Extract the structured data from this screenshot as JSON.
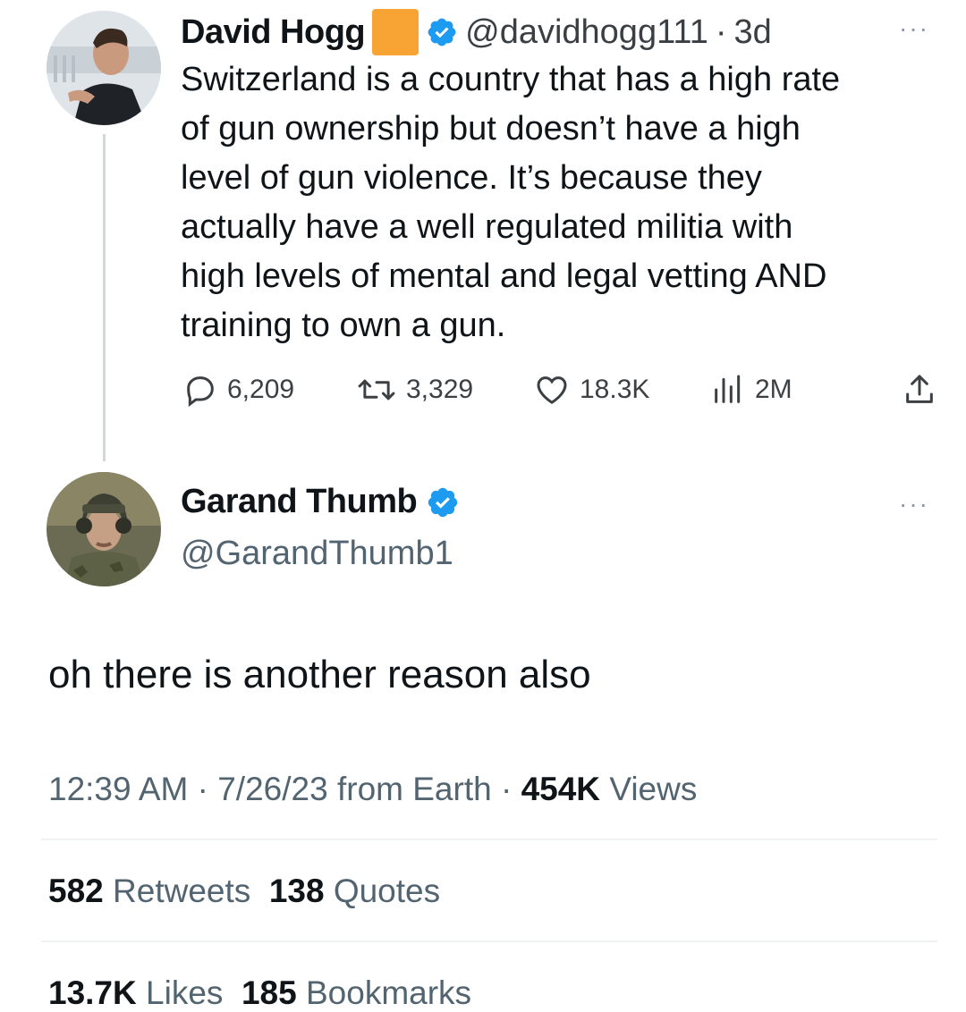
{
  "quoted_tweet": {
    "author_name": "David Hogg",
    "handle": "@davidhogg111",
    "separator": "·",
    "age": "3d",
    "more": "···",
    "text": "Switzerland is a country that has a high rate of gun ownership but doesn’t have a high level of gun violence. It’s because they actually have a well regulated militia with high levels of mental and legal vetting AND training to own a gun.",
    "lines": [
      "Switzerland is a country that has a high rate",
      "of gun ownership but doesn’t have a high",
      "level of gun violence. It’s because they",
      "actually have a well regulated militia with",
      "high levels of mental and legal vetting AND",
      "training to own a gun."
    ],
    "actions": {
      "replies": "6,209",
      "retweets": "3,329",
      "likes": "18.3K",
      "views": "2M"
    }
  },
  "main_tweet": {
    "author_name": "Garand Thumb",
    "handle": "@GarandThumb1",
    "more": "···",
    "text": "oh there is another reason also",
    "time": "12:39 AM",
    "date": "7/26/23",
    "source": "from Earth",
    "dot": "·",
    "views_count": "454K",
    "views_label": "Views",
    "retweets_count": "582",
    "retweets_label": "Retweets",
    "quotes_count": "138",
    "quotes_label": "Quotes",
    "likes_count": "13.7K",
    "likes_label": "Likes",
    "bookmarks_count": "185",
    "bookmarks_label": "Bookmarks"
  },
  "colors": {
    "verified_blue": "#1d9bf0",
    "orange_square": "#f7a434",
    "text_primary": "#0f1419",
    "text_secondary": "#536471"
  },
  "icons": [
    "verified-badge-icon",
    "orange-square-emoji",
    "reply-icon",
    "retweet-icon",
    "like-icon",
    "views-icon",
    "share-icon",
    "more-icon"
  ]
}
